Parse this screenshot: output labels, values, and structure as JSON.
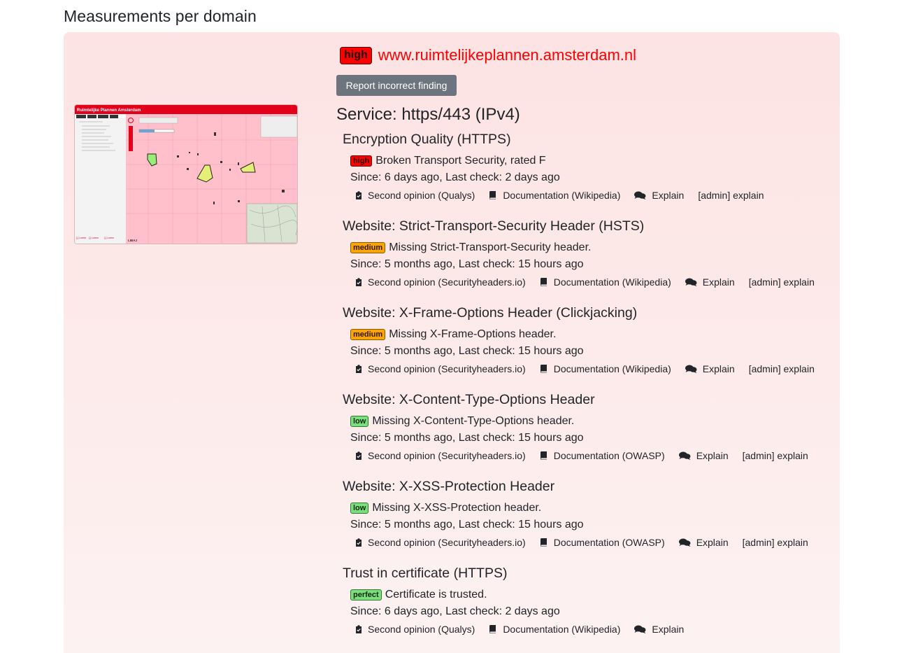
{
  "page_title": "Measurements per domain",
  "domain": {
    "severity": "high",
    "name": "www.ruimtelijkeplannen.amsterdam.nl",
    "report_button": "Report incorrect finding"
  },
  "thumbnail": {
    "app_title": "Ruimtelijke Plannen Amsterdam",
    "tabs": [
      "Plannen",
      "Kaarten",
      "Legenda",
      "Help"
    ],
    "bottom_links": [
      "[-] Lorem",
      "[-] Lorem",
      "[-] Lorem"
    ],
    "logo": "LIBAJ"
  },
  "service": "Service: https/443 (IPv4)",
  "findings": [
    {
      "title": "Encryption Quality (HTTPS)",
      "severity": "high",
      "status": "Broken Transport Security, rated F",
      "since": "Since: 6 days ago, Last check: 2 days ago",
      "second_opinion": "Second opinion (Qualys)",
      "documentation": "Documentation (Wikipedia)",
      "explain": "Explain",
      "admin_explain": "[admin] explain"
    },
    {
      "title": "Website: Strict-Transport-Security Header (HSTS)",
      "severity": "medium",
      "status": "Missing Strict-Transport-Security header.",
      "since": "Since: 5 months ago, Last check: 15 hours ago",
      "second_opinion": "Second opinion (Securityheaders.io)",
      "documentation": "Documentation (Wikipedia)",
      "explain": "Explain",
      "admin_explain": "[admin] explain"
    },
    {
      "title": "Website: X-Frame-Options Header (Clickjacking)",
      "severity": "medium",
      "status": "Missing X-Frame-Options header.",
      "since": "Since: 5 months ago, Last check: 15 hours ago",
      "second_opinion": "Second opinion (Securityheaders.io)",
      "documentation": "Documentation (Wikipedia)",
      "explain": "Explain",
      "admin_explain": "[admin] explain"
    },
    {
      "title": "Website: X-Content-Type-Options Header",
      "severity": "low",
      "status": "Missing X-Content-Type-Options header.",
      "since": "Since: 5 months ago, Last check: 15 hours ago",
      "second_opinion": "Second opinion (Securityheaders.io)",
      "documentation": "Documentation (OWASP)",
      "explain": "Explain",
      "admin_explain": "[admin] explain"
    },
    {
      "title": "Website: X-XSS-Protection Header",
      "severity": "low",
      "status": "Missing X-XSS-Protection header.",
      "since": "Since: 5 months ago, Last check: 15 hours ago",
      "second_opinion": "Second opinion (Securityheaders.io)",
      "documentation": "Documentation (OWASP)",
      "explain": "Explain",
      "admin_explain": "[admin] explain"
    },
    {
      "title": "Trust in certificate (HTTPS)",
      "severity": "perfect",
      "status": "Certificate is trusted.",
      "since": "Since: 6 days ago, Last check: 2 days ago",
      "second_opinion": "Second opinion (Qualys)",
      "documentation": "Documentation (Wikipedia)",
      "explain": "Explain"
    }
  ],
  "colors": {
    "high": "#ff0000",
    "medium": "#ffa500",
    "low": "#7dde7d",
    "perfect": "#7dde7d",
    "card_bg": "#fde3e3",
    "button_bg": "#6c757d"
  }
}
